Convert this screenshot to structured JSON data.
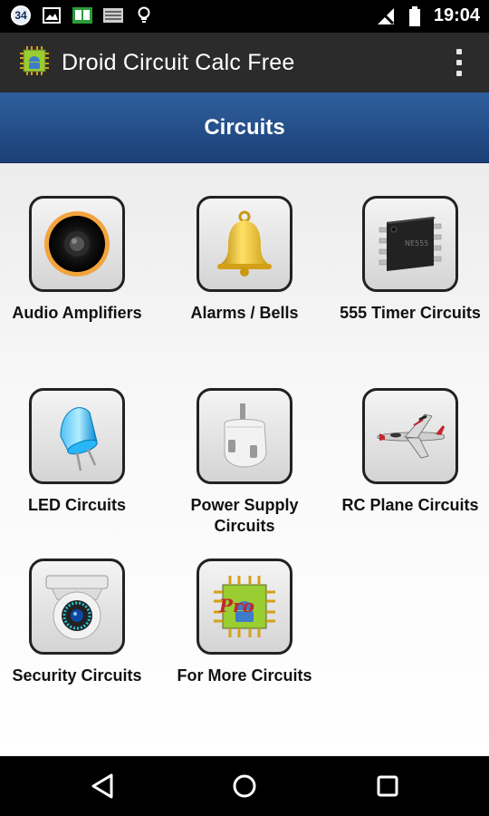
{
  "status_bar": {
    "notification_badge": "34",
    "time": "19:04",
    "left_icons": [
      "image-icon",
      "book-icon",
      "keyboard-icon",
      "bulb-icon"
    ],
    "right_icons": [
      "signal-off-icon",
      "battery-icon"
    ]
  },
  "action_bar": {
    "title": "Droid Circuit Calc Free",
    "app_icon": "chip-android-icon",
    "menu_icon": "overflow-menu-icon"
  },
  "header": {
    "title": "Circuits"
  },
  "circuits": [
    {
      "label": "Audio Amplifiers",
      "icon": "speaker-icon"
    },
    {
      "label": "Alarms / Bells",
      "icon": "bell-icon"
    },
    {
      "label": "555 Timer Circuits",
      "icon": "ic-chip-icon"
    },
    {
      "label": "LED Circuits",
      "icon": "led-icon"
    },
    {
      "label": "Power Supply Circuits",
      "icon": "plug-icon"
    },
    {
      "label": "RC Plane Circuits",
      "icon": "airplane-icon"
    },
    {
      "label": "Security Circuits",
      "icon": "camera-icon"
    },
    {
      "label": "For More Circuits",
      "icon": "pro-chip-icon"
    }
  ],
  "nav_bar": {
    "back": "back-icon",
    "home": "home-icon",
    "recents": "recents-icon"
  },
  "colors": {
    "header_top": "#2f5f9e",
    "header_bottom": "#1c4076",
    "action_bar": "#2b2b2b"
  }
}
